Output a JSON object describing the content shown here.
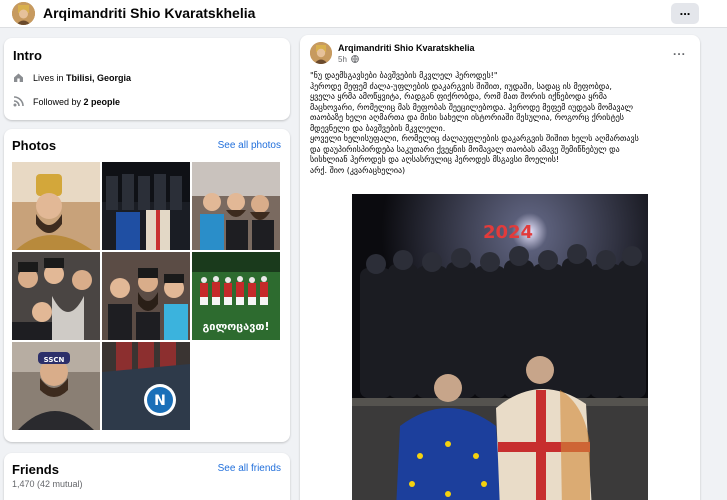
{
  "header": {
    "page_name": "Arqimandriti Shio Kvaratskhelia",
    "more_label": "..."
  },
  "intro": {
    "title": "Intro",
    "lives_prefix": "Lives in",
    "lives_place": "Tbilisi, Georgia",
    "followed_prefix": "Followed by",
    "followed_count": "2 people"
  },
  "photos": {
    "title": "Photos",
    "see_all": "See all photos",
    "tile4_caption": "გილოცავთ!",
    "tile7_caption": "SSCN"
  },
  "friends": {
    "title": "Friends",
    "see_all": "See all friends",
    "count": "1,470 (42 mutual)"
  },
  "post": {
    "author": "Arqimandriti Shio Kvaratskhelia",
    "time": "5h",
    "more_label": "...",
    "text": "\"ნუ დაემსგავსები ბავშვების მკვლელ ჰეროდეს!\"\nჰეროდე მეფემ ძალა-უფლების დაკარგვის შიშით, იუდაში, სადაც ის მეფობდა,\nყველა ყრმა ამოწყვიტა, რადგან ფიქრობდა, რომ მათ შორის იქნებოდა ყრმა\nმაცხოვარი, რომელიც მას მეფობას შეეცილებოდა. ჰეროდე მეფემ იუდეას მომავალ\nთაობაზე ხელი აღმართა და მისი სახელი ისტორიაში შესულია, როგორც ქრისტეს\nმდევნელი და ბავშვების მკვლელი.\nყოველი ხელისუფალი, რომელიც ძალაუფლების დაკარგვის შიშით ხელს აღმართავს\nდა დაუპირისპირდება საკუთარი ქვეყნის მომავალ თაობას ამავე შემიწნებულ და\nსისხლიან ჰეროდეს და აღსასრულიც ჰეროდეს მსგავსი მოელის!\nარქ. შიო (კვარაცხელია)",
    "image_year": "2024"
  }
}
